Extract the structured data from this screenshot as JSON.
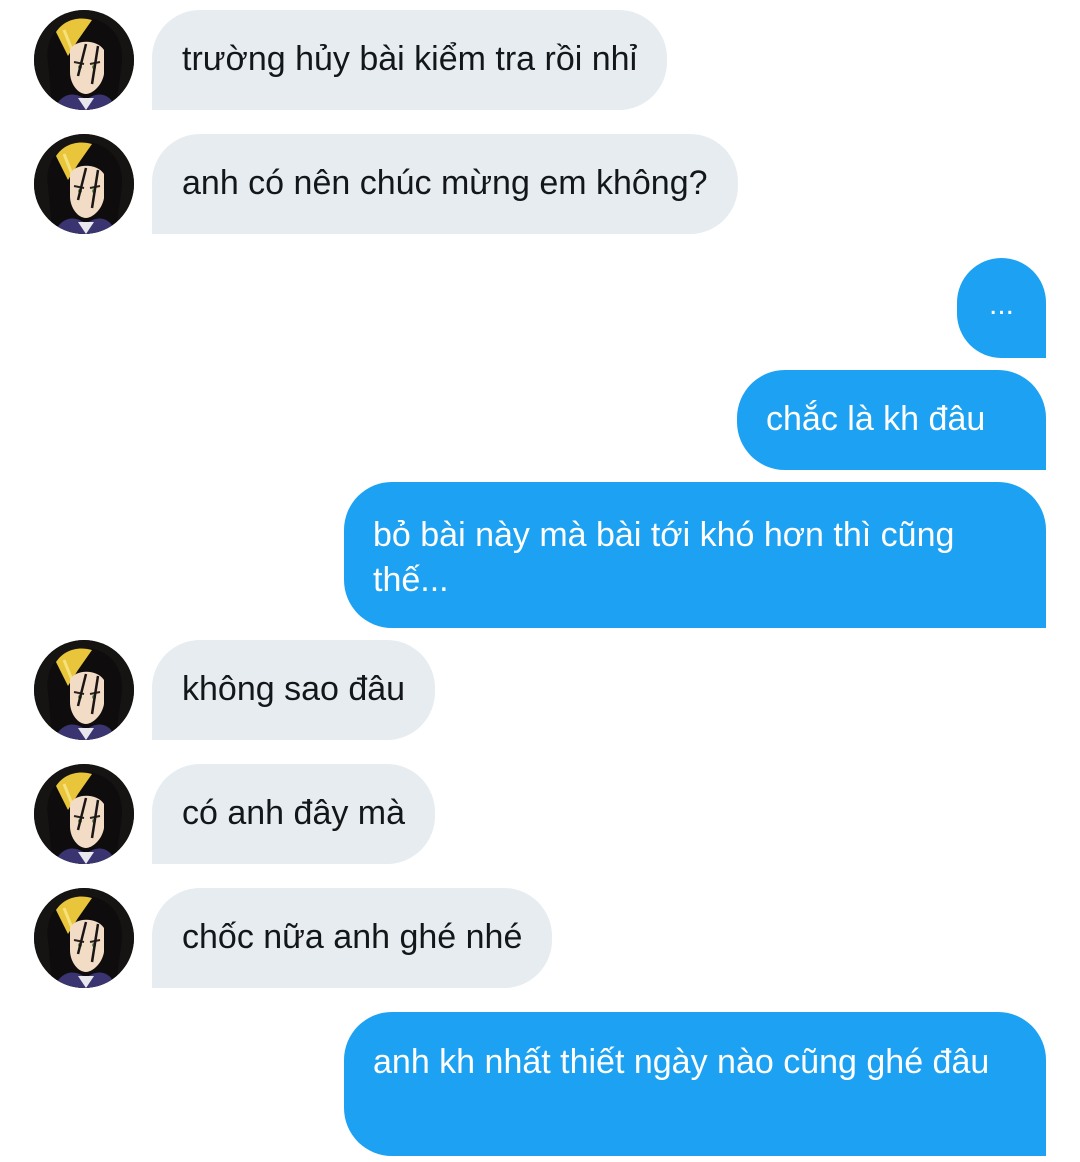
{
  "messages": [
    {
      "side": "incoming",
      "text": "trường hủy bài kiểm tra rồi nhỉ"
    },
    {
      "side": "incoming",
      "text": "anh có nên chúc mừng em không?"
    },
    {
      "side": "outgoing",
      "text": "..."
    },
    {
      "side": "outgoing",
      "text": "chắc là kh đâu"
    },
    {
      "side": "outgoing",
      "text": "bỏ bài này mà bài tới khó hơn thì cũng thế..."
    },
    {
      "side": "incoming",
      "text": "không sao đâu"
    },
    {
      "side": "incoming",
      "text": "có anh đây mà"
    },
    {
      "side": "incoming",
      "text": "chốc nữa anh ghé nhé"
    },
    {
      "side": "outgoing",
      "text": "anh kh nhất thiết ngày nào cũng ghé đâu"
    }
  ],
  "colors": {
    "incoming_bubble": "#e6ecf0",
    "incoming_text": "#14171a",
    "outgoing_bubble": "#1da1f2",
    "outgoing_text": "#ffffff",
    "background": "#ffffff"
  },
  "icons": {
    "avatar": "profile-avatar-illustrated-dark-hair"
  }
}
